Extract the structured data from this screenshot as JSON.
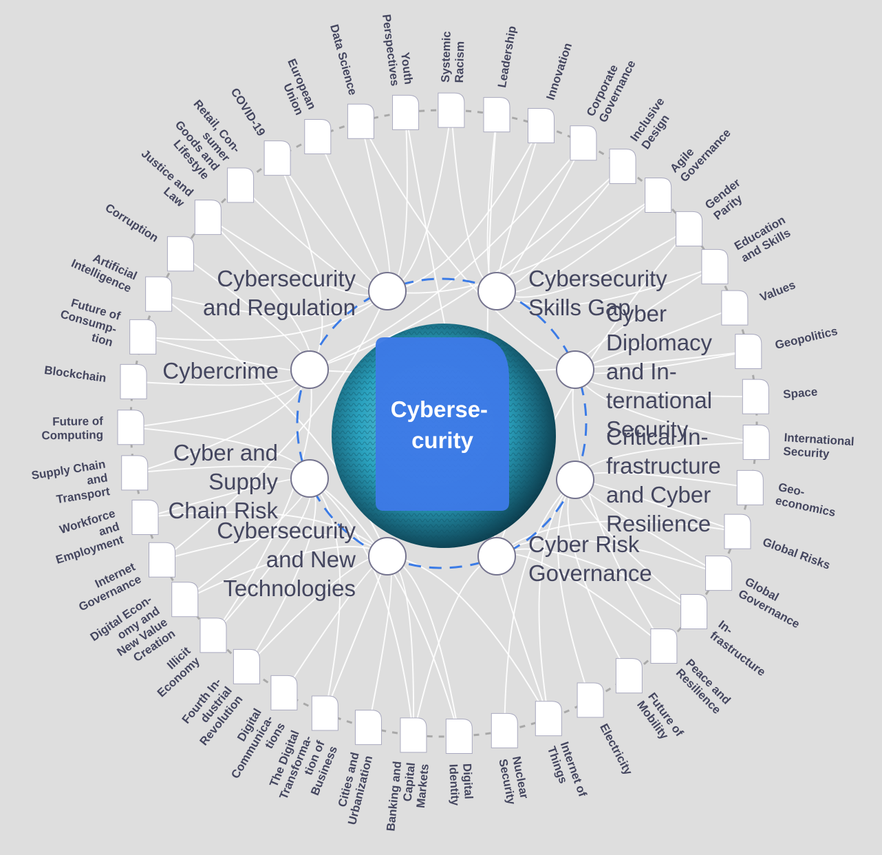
{
  "center": {
    "title_lines": [
      "Cyberse-",
      "curity"
    ],
    "colors": {
      "card": "#3d7ae6",
      "ring": "#3b7be6",
      "image_tint": "#2aa2bf"
    }
  },
  "inner_topics": [
    {
      "label_lines": [
        "Cybersecurity",
        "Skills Gap"
      ],
      "side": "right"
    },
    {
      "label_lines": [
        "Cyber",
        "Diplomacy",
        "and In-",
        "ternational",
        "Security"
      ],
      "side": "right"
    },
    {
      "label_lines": [
        "Critical In-",
        "frastructure",
        "and Cyber",
        "Resilience"
      ],
      "side": "right"
    },
    {
      "label_lines": [
        "Cyber Risk",
        "Governance"
      ],
      "side": "right"
    },
    {
      "label_lines": [
        "Cybersecurity",
        "and New",
        "Technologies"
      ],
      "side": "left"
    },
    {
      "label_lines": [
        "Cyber and",
        "Supply",
        "Chain Risk"
      ],
      "side": "left"
    },
    {
      "label_lines": [
        "Cybercrime"
      ],
      "side": "left"
    },
    {
      "label_lines": [
        "Cybersecurity",
        "and Regulation"
      ],
      "side": "left"
    }
  ],
  "outer_topics": [
    {
      "label_lines": [
        "Youth",
        "Perspectives"
      ]
    },
    {
      "label_lines": [
        "Systemic",
        "Racism"
      ]
    },
    {
      "label_lines": [
        "Leadership"
      ]
    },
    {
      "label_lines": [
        "Innovation"
      ]
    },
    {
      "label_lines": [
        "Corporate",
        "Governance"
      ]
    },
    {
      "label_lines": [
        "Inclusive",
        "Design"
      ]
    },
    {
      "label_lines": [
        "Agile",
        "Governance"
      ]
    },
    {
      "label_lines": [
        "Gender",
        "Parity"
      ]
    },
    {
      "label_lines": [
        "Education",
        "and Skills"
      ]
    },
    {
      "label_lines": [
        "Values"
      ]
    },
    {
      "label_lines": [
        "Geopolitics"
      ]
    },
    {
      "label_lines": [
        "Space"
      ]
    },
    {
      "label_lines": [
        "International",
        "Security"
      ]
    },
    {
      "label_lines": [
        "Geo-",
        "economics"
      ]
    },
    {
      "label_lines": [
        "Global Risks"
      ]
    },
    {
      "label_lines": [
        "Global",
        "Governance"
      ]
    },
    {
      "label_lines": [
        "In-",
        "frastructure"
      ]
    },
    {
      "label_lines": [
        "Peace and",
        "Resilience"
      ]
    },
    {
      "label_lines": [
        "Future of",
        "Mobility"
      ]
    },
    {
      "label_lines": [
        "Electricity"
      ]
    },
    {
      "label_lines": [
        "Internet of",
        "Things"
      ]
    },
    {
      "label_lines": [
        "Nuclear",
        "Security"
      ]
    },
    {
      "label_lines": [
        "Digital",
        "Identity"
      ]
    },
    {
      "label_lines": [
        "Banking and",
        "Capital",
        "Markets"
      ]
    },
    {
      "label_lines": [
        "Cities and",
        "Urbanization"
      ]
    },
    {
      "label_lines": [
        "The Digital",
        "Transforma-",
        "tion of",
        "Business"
      ]
    },
    {
      "label_lines": [
        "Digital",
        "Communica-",
        "tions"
      ]
    },
    {
      "label_lines": [
        "Fourth In-",
        "dustrial",
        "Revolution"
      ]
    },
    {
      "label_lines": [
        "Illicit",
        "Economy"
      ]
    },
    {
      "label_lines": [
        "Digital Econ-",
        "omy and",
        "New Value",
        "Creation"
      ]
    },
    {
      "label_lines": [
        "Internet",
        "Governance"
      ]
    },
    {
      "label_lines": [
        "Workforce",
        "and",
        "Employment"
      ]
    },
    {
      "label_lines": [
        "Supply Chain",
        "and",
        "Transport"
      ]
    },
    {
      "label_lines": [
        "Future of",
        "Computing"
      ]
    },
    {
      "label_lines": [
        "Blockchain"
      ]
    },
    {
      "label_lines": [
        "Future of",
        "Consump-",
        "tion"
      ]
    },
    {
      "label_lines": [
        "Artificial",
        "Intelligence"
      ]
    },
    {
      "label_lines": [
        "Corruption"
      ]
    },
    {
      "label_lines": [
        "Justice and",
        "Law"
      ]
    },
    {
      "label_lines": [
        "Retail, Con-",
        "sumer",
        "Goods and",
        "Lifestyle"
      ]
    },
    {
      "label_lines": [
        "COVID-19"
      ]
    },
    {
      "label_lines": [
        "European",
        "Union"
      ]
    },
    {
      "label_lines": [
        "Data Science"
      ]
    }
  ],
  "links": [
    [
      0,
      7
    ],
    [
      0,
      3
    ],
    [
      1,
      0
    ],
    [
      1,
      7
    ],
    [
      2,
      0
    ],
    [
      2,
      3
    ],
    [
      3,
      0
    ],
    [
      3,
      7
    ],
    [
      4,
      6
    ],
    [
      4,
      0
    ],
    [
      5,
      6
    ],
    [
      5,
      0
    ],
    [
      6,
      0
    ],
    [
      6,
      7
    ],
    [
      7,
      0
    ],
    [
      7,
      3
    ],
    [
      8,
      0
    ],
    [
      8,
      1
    ],
    [
      9,
      1
    ],
    [
      10,
      1
    ],
    [
      10,
      6
    ],
    [
      11,
      1
    ],
    [
      12,
      1
    ],
    [
      12,
      2
    ],
    [
      13,
      2
    ],
    [
      14,
      2
    ],
    [
      14,
      3
    ],
    [
      15,
      2
    ],
    [
      15,
      3
    ],
    [
      16,
      2
    ],
    [
      16,
      3
    ],
    [
      17,
      3
    ],
    [
      17,
      1
    ],
    [
      18,
      2
    ],
    [
      19,
      2
    ],
    [
      20,
      2
    ],
    [
      20,
      3
    ],
    [
      20,
      4
    ],
    [
      21,
      2
    ],
    [
      22,
      4
    ],
    [
      22,
      5
    ],
    [
      23,
      4
    ],
    [
      23,
      5
    ],
    [
      23,
      3
    ],
    [
      24,
      4
    ],
    [
      25,
      4
    ],
    [
      25,
      5
    ],
    [
      26,
      4
    ],
    [
      27,
      4
    ],
    [
      27,
      5
    ],
    [
      28,
      6
    ],
    [
      28,
      5
    ],
    [
      29,
      4
    ],
    [
      29,
      5
    ],
    [
      30,
      4
    ],
    [
      30,
      7
    ],
    [
      31,
      4
    ],
    [
      31,
      5
    ],
    [
      32,
      5
    ],
    [
      32,
      6
    ],
    [
      33,
      5
    ],
    [
      33,
      6
    ],
    [
      34,
      6
    ],
    [
      35,
      7
    ],
    [
      35,
      6
    ],
    [
      36,
      7
    ],
    [
      36,
      4
    ],
    [
      37,
      6
    ],
    [
      38,
      7
    ],
    [
      38,
      6
    ],
    [
      39,
      7
    ],
    [
      40,
      7
    ],
    [
      40,
      6
    ],
    [
      41,
      7
    ],
    [
      42,
      7
    ],
    [
      42,
      1
    ]
  ]
}
